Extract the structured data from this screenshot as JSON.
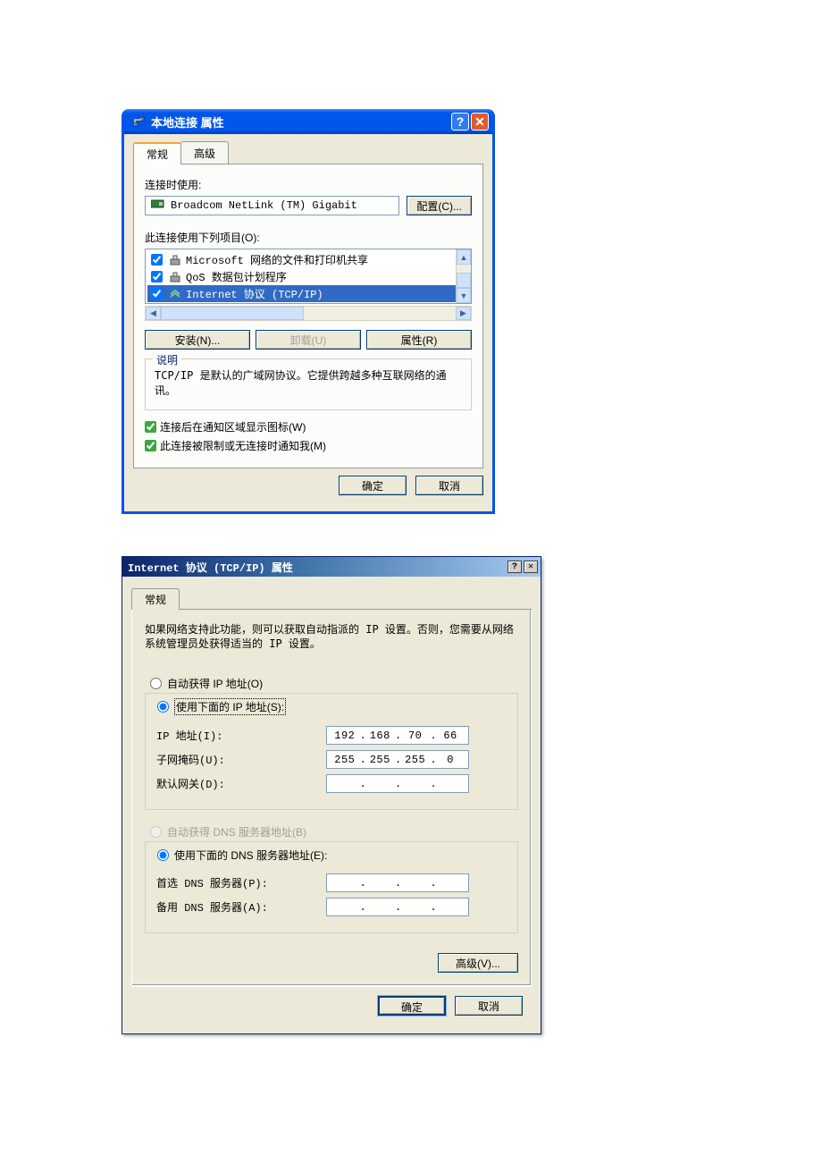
{
  "window1": {
    "title": "本地连接 属性",
    "tabs": [
      "常规",
      "高级"
    ],
    "connect_using_label": "连接时使用:",
    "adapter_name": "Broadcom NetLink (TM) Gigabit",
    "configure_btn": "配置(C)...",
    "items_label": "此连接使用下列项目(O):",
    "items": [
      {
        "checked": true,
        "text": "Microsoft 网络的文件和打印机共享",
        "selected": false
      },
      {
        "checked": true,
        "text": "QoS 数据包计划程序",
        "selected": false
      },
      {
        "checked": true,
        "text": "Internet 协议 (TCP/IP)",
        "selected": true
      }
    ],
    "install_btn": "安装(N)...",
    "uninstall_btn": "卸载(U)",
    "properties_btn": "属性(R)",
    "description_title": "说明",
    "description_text": "TCP/IP 是默认的广域网协议。它提供跨越多种互联网络的通讯。",
    "show_icon_check": "连接后在通知区域显示图标(W)",
    "limited_notify_check": "此连接被限制或无连接时通知我(M)",
    "ok_btn": "确定",
    "cancel_btn": "取消"
  },
  "window2": {
    "title": "Internet 协议 (TCP/IP) 属性",
    "tab": "常规",
    "intro": "如果网络支持此功能，则可以获取自动指派的 IP 设置。否则，您需要从网络系统管理员处获得适当的 IP 设置。",
    "radio_auto_ip": "自动获得 IP 地址(O)",
    "radio_use_ip": "使用下面的 IP 地址(S):",
    "ip_label": "IP 地址(I):",
    "ip_value": [
      "192",
      "168",
      "70",
      "66"
    ],
    "subnet_label": "子网掩码(U):",
    "subnet_value": [
      "255",
      "255",
      "255",
      "0"
    ],
    "gateway_label": "默认网关(D):",
    "gateway_value": [
      "",
      "",
      "",
      ""
    ],
    "radio_auto_dns": "自动获得 DNS 服务器地址(B)",
    "radio_use_dns": "使用下面的 DNS 服务器地址(E):",
    "dns1_label": "首选 DNS 服务器(P):",
    "dns1_value": [
      "",
      "",
      "",
      ""
    ],
    "dns2_label": "备用 DNS 服务器(A):",
    "dns2_value": [
      "",
      "",
      "",
      ""
    ],
    "advanced_btn": "高级(V)...",
    "ok_btn": "确定",
    "cancel_btn": "取消"
  }
}
